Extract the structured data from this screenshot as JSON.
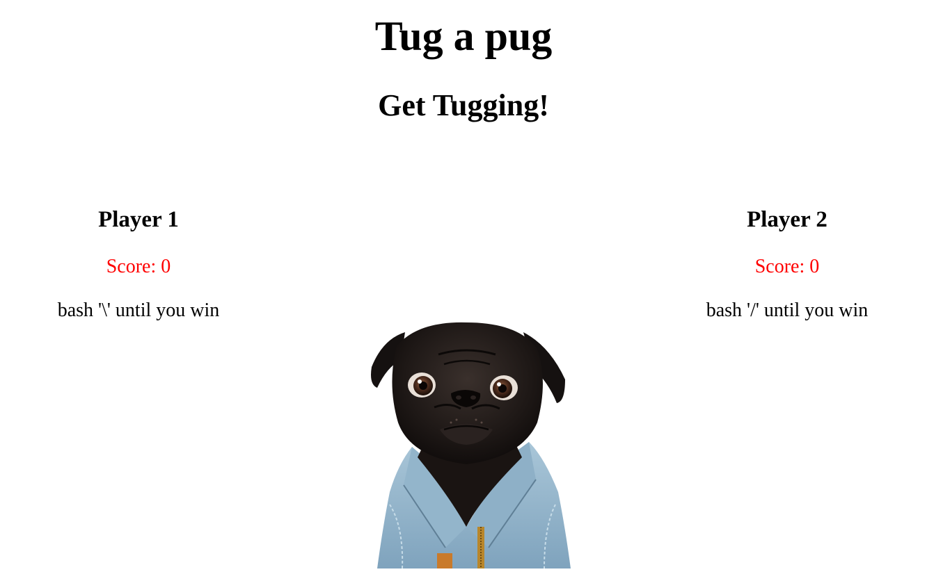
{
  "header": {
    "title": "Tug a pug",
    "subtitle": "Get Tugging!"
  },
  "players": [
    {
      "name": "Player 1",
      "score_label": "Score:",
      "score": "0",
      "instruction": "bash '\\' until you win"
    },
    {
      "name": "Player 2",
      "score_label": "Score:",
      "score": "0",
      "instruction": "bash '/' until you win"
    }
  ],
  "colors": {
    "score": "#ff0000",
    "text": "#000000",
    "background": "#ffffff"
  },
  "image": {
    "subject": "pug-in-denim-jacket"
  }
}
